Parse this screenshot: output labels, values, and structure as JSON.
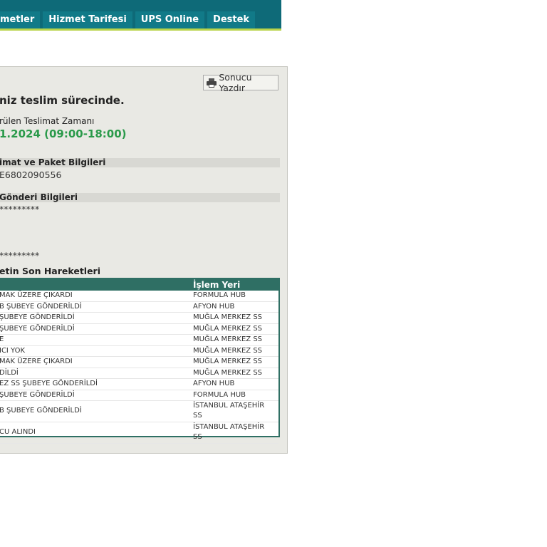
{
  "nav": {
    "tabs": [
      "metler",
      "Hizmet Tarifesi",
      "UPS Online",
      "Destek"
    ]
  },
  "panel": {
    "print_button": "Sonucu Yazdır",
    "status": "niz teslim sürecinde.",
    "eta_label": "rülen Teslimat Zamanı",
    "eta_value": "1.2024 (09:00-18:00)",
    "delivery_section": {
      "heading": "imat ve Paket Bilgileri",
      "value": "E6802090556"
    },
    "shipment_section": {
      "heading": "Gönderi Bilgileri",
      "line1": "*********",
      "line2": "*********"
    },
    "history": {
      "heading": "etin Son Hareketleri",
      "col_location": "İşlem Yeri",
      "rows": [
        {
          "event": "MAK ÜZERE ÇIKARDI",
          "location": "FORMULA HUB"
        },
        {
          "event": "B ŞUBEYE GÖNDERİLDİ",
          "location": "AFYON HUB"
        },
        {
          "event": "ŞUBEYE GÖNDERİLDİ",
          "location": "MUĞLA MERKEZ SS"
        },
        {
          "event": "ŞUBEYE GÖNDERİLDİ",
          "location": "MUĞLA MERKEZ SS"
        },
        {
          "event": "E",
          "location": "MUĞLA MERKEZ SS"
        },
        {
          "event": "ICI YOK",
          "location": "MUĞLA MERKEZ SS"
        },
        {
          "event": "MAK ÜZERE ÇIKARDI",
          "location": "MUĞLA MERKEZ SS"
        },
        {
          "event": "DİLDİ",
          "location": "MUĞLA MERKEZ SS"
        },
        {
          "event": "EZ SS ŞUBEYE GÖNDERİLDİ",
          "location": "AFYON HUB"
        },
        {
          "event": "ŞUBEYE GÖNDERİLDİ",
          "location": "FORMULA HUB"
        },
        {
          "event": "B ŞUBEYE GÖNDERİLDİ",
          "location": "İSTANBUL ATAŞEHİR SS"
        },
        {
          "event": "CU ALINDI",
          "location": "İSTANBUL ATAŞEHİR SS"
        }
      ]
    }
  }
}
